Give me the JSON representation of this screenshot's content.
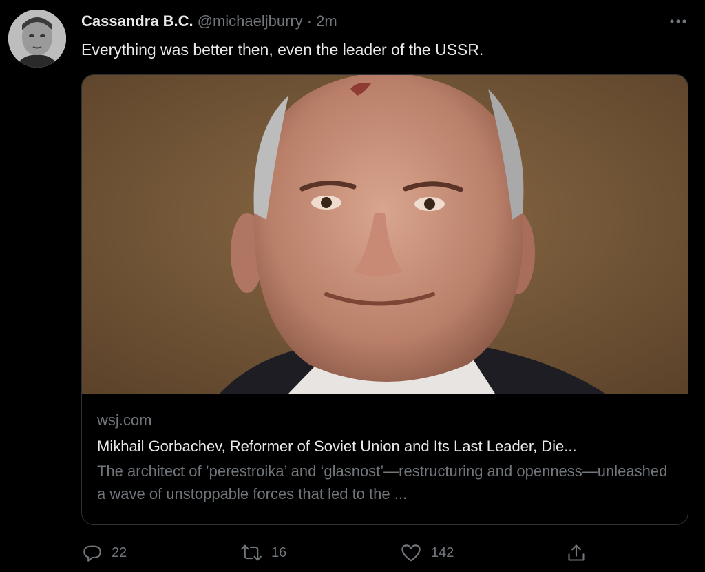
{
  "author": {
    "name": "Cassandra B.C.",
    "handle": "@michaeljburry",
    "separator": "·",
    "time": "2m"
  },
  "tweet": {
    "text": "Everything was better then, even the leader of the USSR."
  },
  "card": {
    "domain": "wsj.com",
    "title": "Mikhail Gorbachev, Reformer of Soviet Union and Its Last Leader, Die...",
    "description": "The architect of ’perestroika’ and ‘glasnost’—restructuring and openness—unleashed a wave of unstoppable forces that led to the ..."
  },
  "actions": {
    "replies": "22",
    "retweets": "16",
    "likes": "142"
  },
  "icons": {
    "more": "more-horizontal-icon",
    "reply": "reply-icon",
    "retweet": "retweet-icon",
    "like": "heart-icon",
    "share": "share-icon"
  },
  "colors": {
    "background": "#000000",
    "text_primary": "#e7e9ea",
    "text_secondary": "#71767b",
    "border": "#2f3336"
  }
}
